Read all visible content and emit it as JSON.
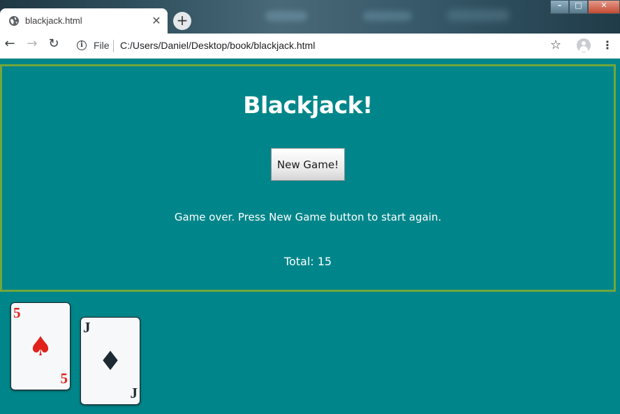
{
  "browser": {
    "tab_title": "blackjack.html",
    "tab_close_glyph": "✕",
    "new_tab_glyph": "+",
    "window_buttons": {
      "minimize": "–",
      "maximize": "□",
      "close": "✕"
    },
    "nav": {
      "back": "←",
      "forward": "→",
      "reload": "↻"
    },
    "info_glyph": "i",
    "file_label": "File",
    "url": "C:/Users/Daniel/Desktop/book/blackjack.html",
    "star_glyph": "☆",
    "menu_glyph": "⋮",
    "icons": [
      "globe-icon",
      "info-icon",
      "star-icon",
      "profile-icon",
      "menu-icon"
    ]
  },
  "game": {
    "title": "Blackjack!",
    "new_game_label": "New Game!",
    "status": "Game over. Press New Game button to start again.",
    "total_label": "Total: 15"
  },
  "cards": [
    {
      "rank": "5",
      "suit_glyph": "♠",
      "suit": "spades",
      "color": "#e0221b"
    },
    {
      "rank": "J",
      "suit_glyph": "♦",
      "suit": "diamonds",
      "color": "#1e2a33"
    }
  ],
  "colors": {
    "page_background": "#00868a",
    "panel_border": "#72a63b",
    "text": "#ffffff"
  }
}
